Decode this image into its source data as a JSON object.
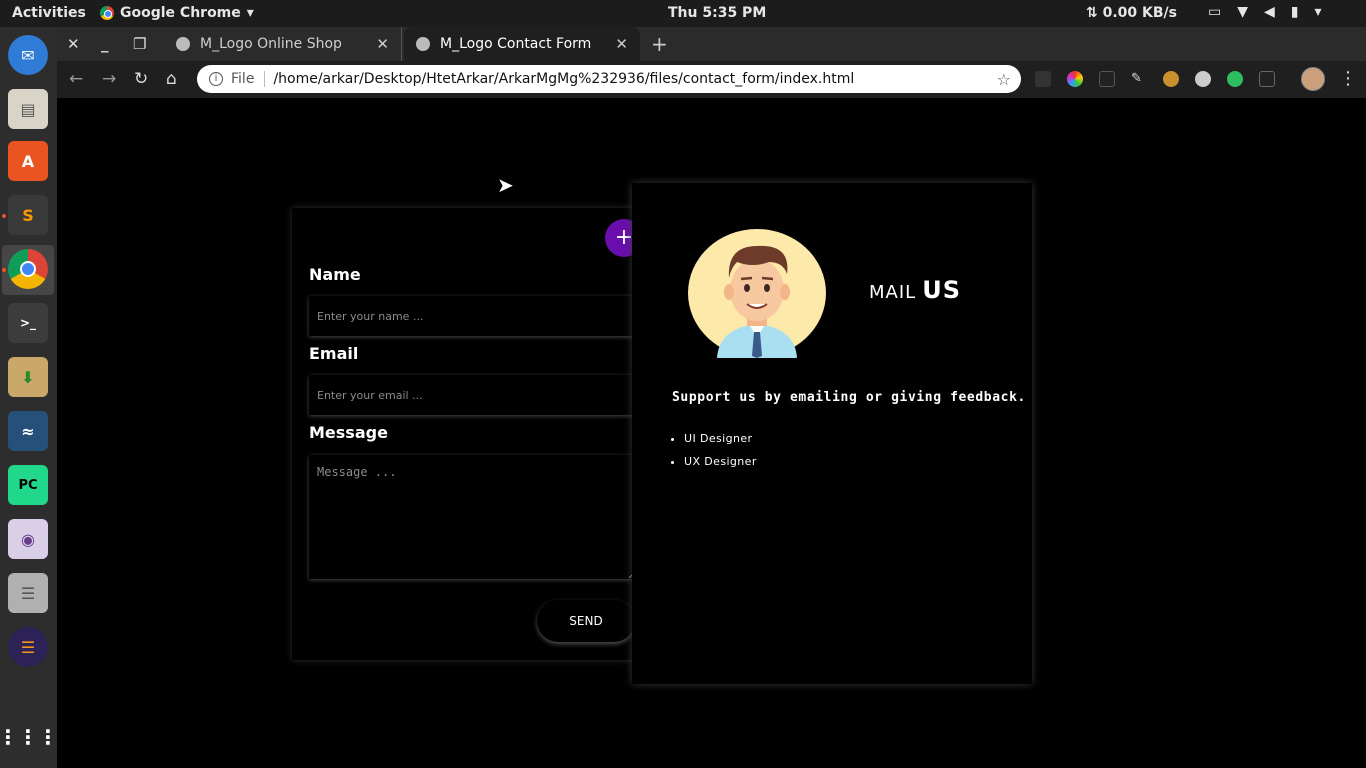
{
  "topbar": {
    "activities": "Activities",
    "app_name": "Google Chrome",
    "clock": "Thu  5:35 PM",
    "net_speed": "0.00 KB/s"
  },
  "dock": {
    "items": [
      "thunderbird-icon",
      "files-icon",
      "software-center-icon",
      "sublime-text-icon",
      "chrome-icon",
      "terminal-icon",
      "archive-manager-icon",
      "mysql-workbench-icon",
      "pycharm-icon",
      "camera-icon",
      "database-icon",
      "eclipse-icon",
      "app-grid-icon"
    ]
  },
  "browser": {
    "tabs": [
      {
        "title": "M_Logo Online Shop",
        "active": false
      },
      {
        "title": "M_Logo Contact Form",
        "active": true
      }
    ],
    "omnibox": {
      "scheme": "File",
      "url": "/home/arkar/Desktop/HtetArkar/ArkarMgMg%232936/files/contact_form/index.html"
    }
  },
  "form": {
    "plus_label": "+",
    "name_label": "Name",
    "name_placeholder": "Enter your name ...",
    "email_label": "Email",
    "email_placeholder": "Enter your email ...",
    "message_label": "Message",
    "message_placeholder": "Message ...",
    "send_label": "SEND"
  },
  "info": {
    "heading_part1": "MAIL",
    "heading_part2": "US",
    "support_text": "Support us by emailing or giving feedback.",
    "roles": [
      "UI Designer",
      "UX Designer"
    ]
  },
  "colors": {
    "accent_purple": "#6a0dad",
    "page_background": "#000000",
    "topbar": "#1c1c1c",
    "dock": "#2d2d2d"
  }
}
